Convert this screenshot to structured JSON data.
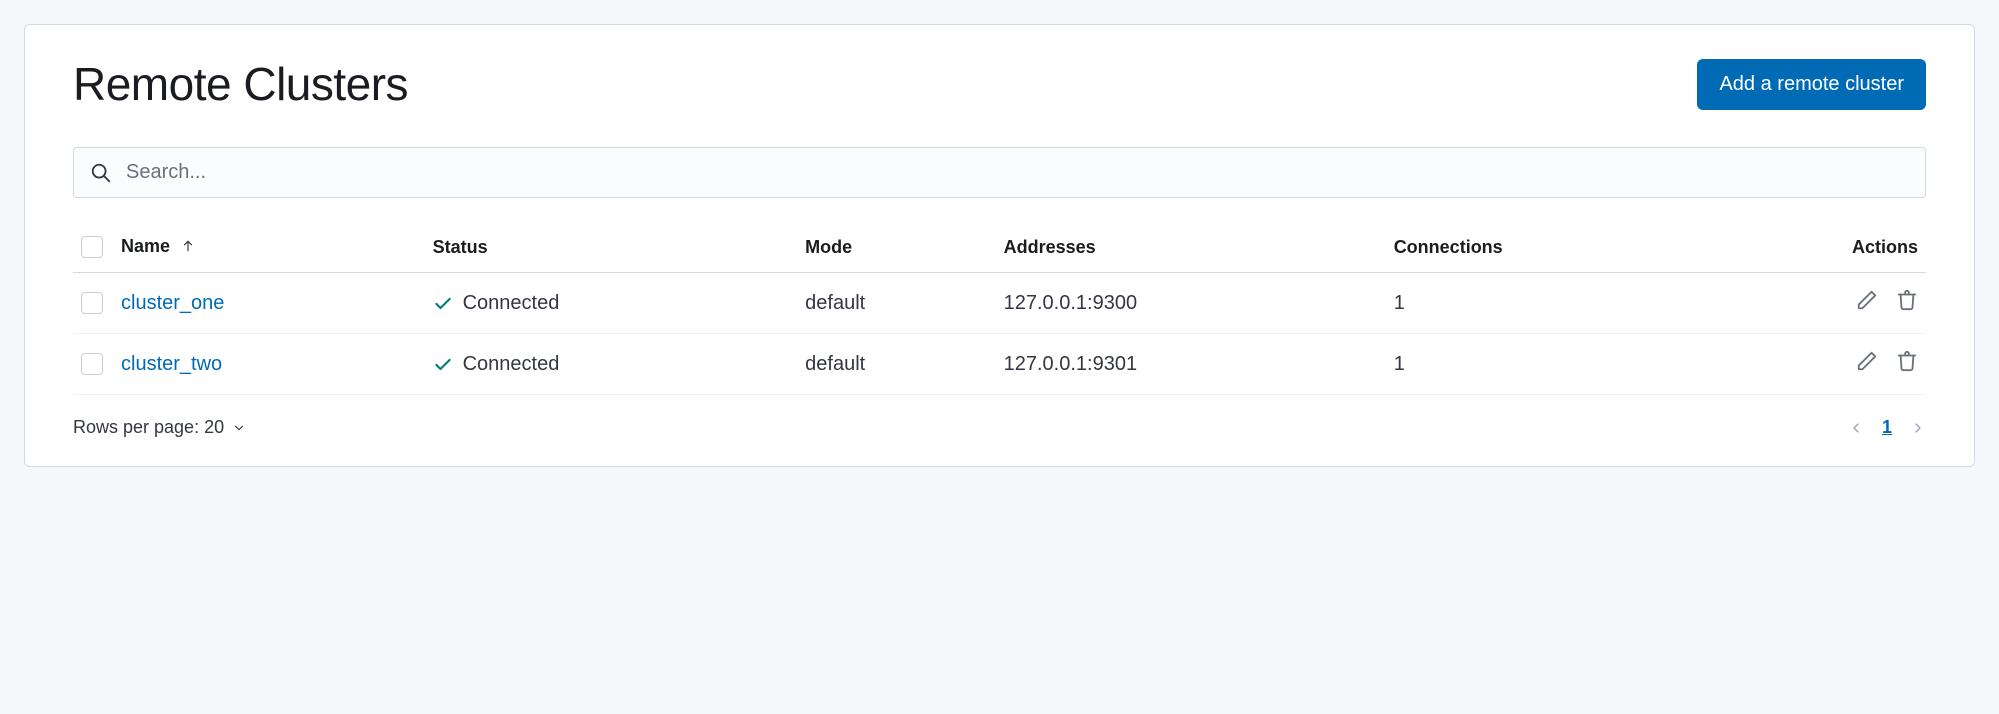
{
  "header": {
    "title": "Remote Clusters",
    "add_button": "Add a remote cluster"
  },
  "search": {
    "placeholder": "Search..."
  },
  "table": {
    "columns": {
      "name": "Name",
      "status": "Status",
      "mode": "Mode",
      "addresses": "Addresses",
      "connections": "Connections",
      "actions": "Actions"
    },
    "rows": [
      {
        "name": "cluster_one",
        "status": "Connected",
        "mode": "default",
        "addresses": "127.0.0.1:9300",
        "connections": "1"
      },
      {
        "name": "cluster_two",
        "status": "Connected",
        "mode": "default",
        "addresses": "127.0.0.1:9301",
        "connections": "1"
      }
    ]
  },
  "footer": {
    "rows_per_page_label": "Rows per page: 20",
    "current_page": "1"
  }
}
